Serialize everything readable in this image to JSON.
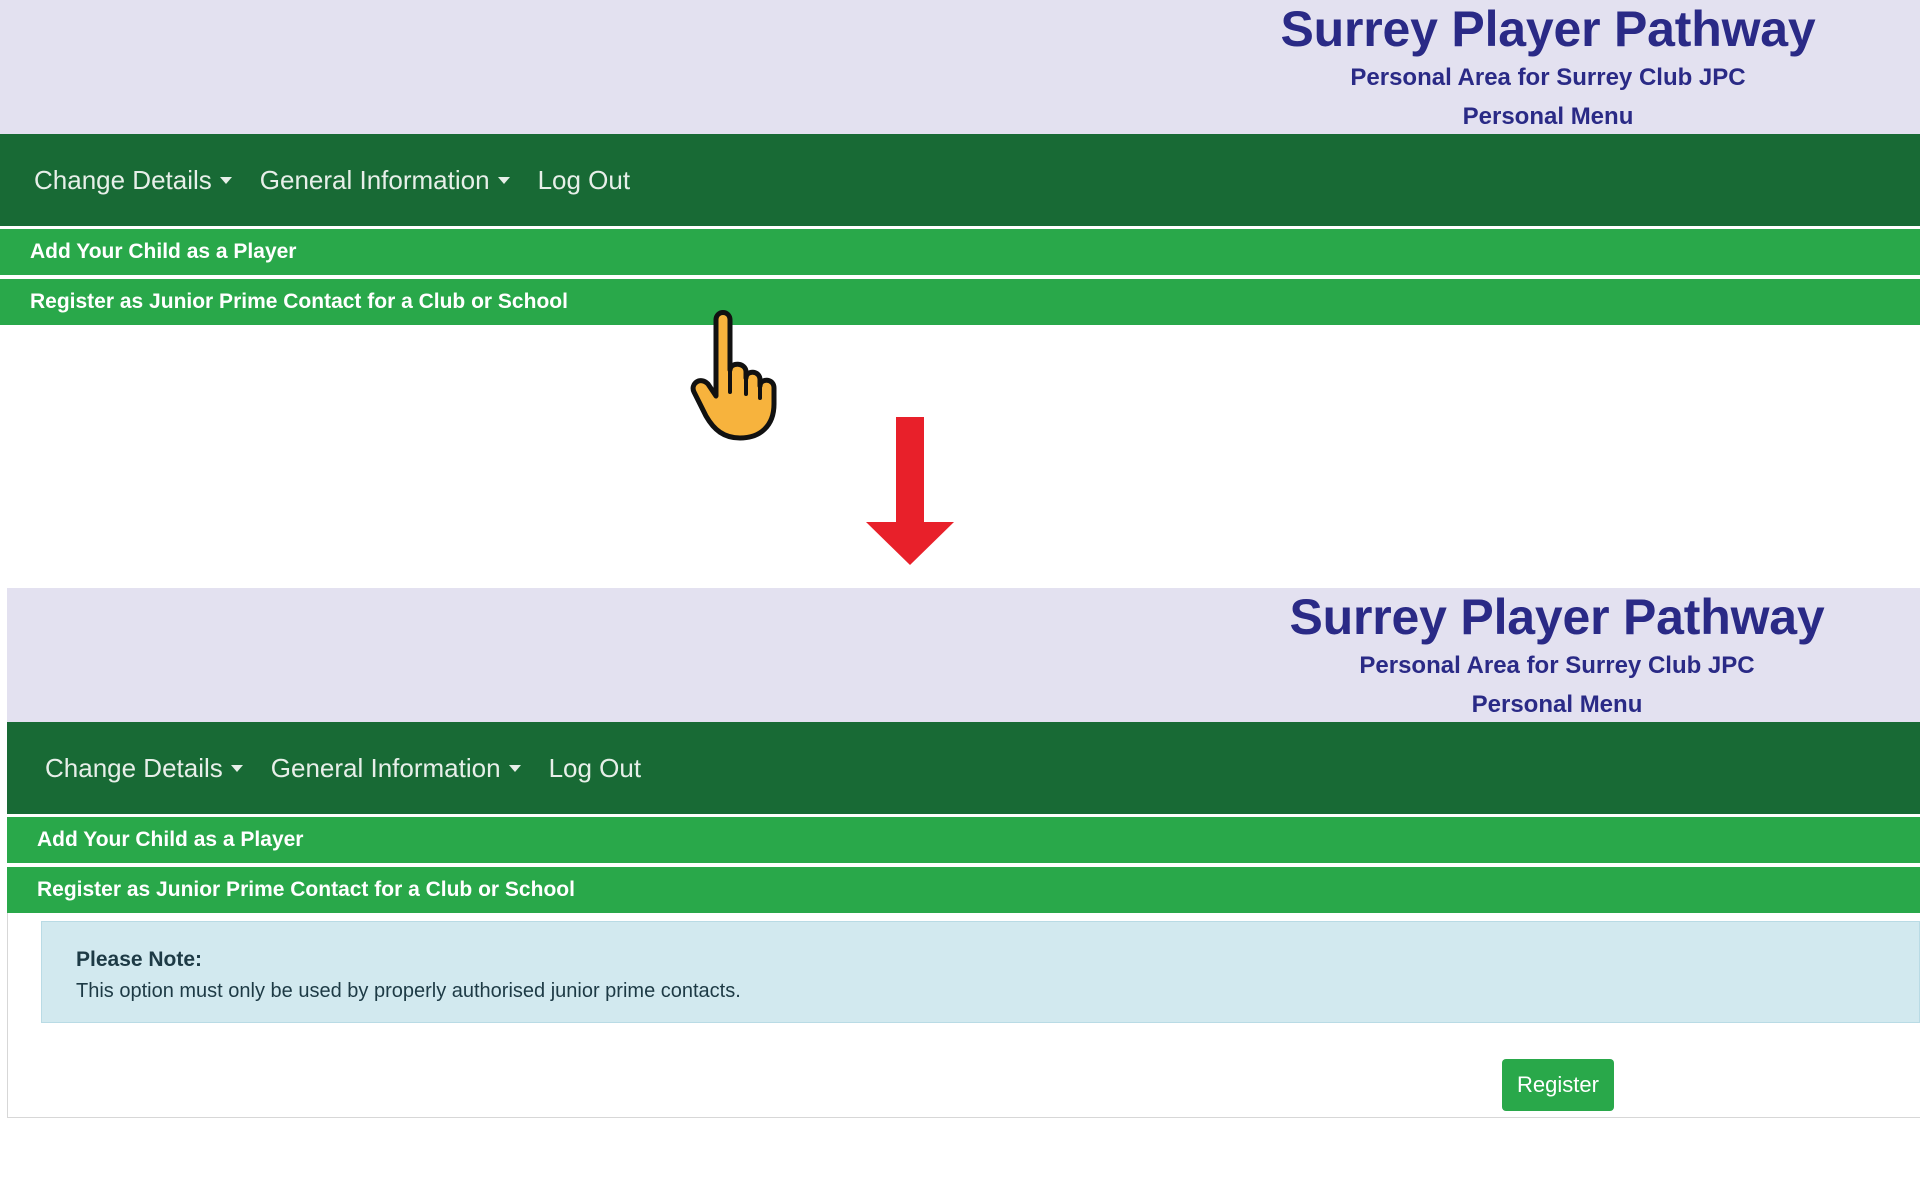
{
  "header": {
    "site_title": "Surrey Player Pathway",
    "subtitle": "Personal Area for Surrey Club JPC",
    "menu_title": "Personal Menu"
  },
  "nav": {
    "change_details": "Change Details",
    "general_information": "General Information",
    "log_out": "Log Out"
  },
  "menu": {
    "add_child": "Add Your Child as a Player",
    "register_jpc": "Register as Junior Prime Contact for a Club or School"
  },
  "note": {
    "title": "Please Note:",
    "body": "This option must only be used by properly authorised junior prime contacts."
  },
  "register_button": "Register",
  "icons": {
    "cursor": "pointing-hand-icon",
    "transition": "arrow-down-icon"
  },
  "colors": {
    "header_bg": "#e3e1f0",
    "title_text": "#2a2a86",
    "navbar_bg": "#186a35",
    "menu_bar_bg": "#29a84a",
    "note_bg": "#d2e9ef",
    "arrow": "#e8202a",
    "hand": "#f7b33d"
  }
}
